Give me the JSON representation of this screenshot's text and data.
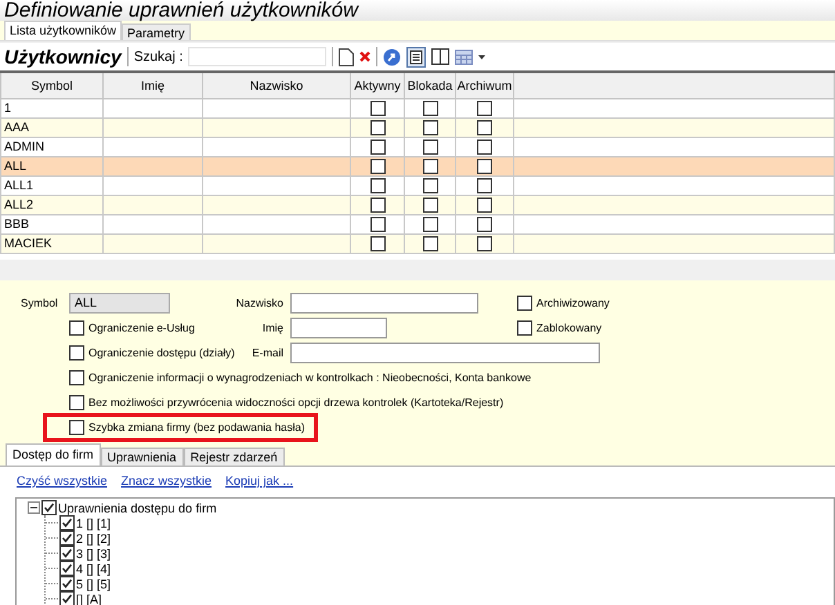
{
  "window": {
    "title": "Definiowanie uprawnień użytkowników"
  },
  "tabs": [
    {
      "label": "Lista użytkowników",
      "selected": true
    },
    {
      "label": "Parametry",
      "selected": false
    }
  ],
  "toolbar": {
    "title": "Użytkownicy",
    "search_label": "Szukaj :"
  },
  "table": {
    "columns": [
      {
        "label": "Symbol",
        "kind": "text"
      },
      {
        "label": "Imię",
        "kind": "text"
      },
      {
        "label": "Nazwisko",
        "kind": "text"
      },
      {
        "label": "Aktywny",
        "kind": "check"
      },
      {
        "label": "Blokada",
        "kind": "check"
      },
      {
        "label": "Archiwum",
        "kind": "check"
      }
    ],
    "rows": [
      {
        "symbol": "1",
        "active": false,
        "blocked": false,
        "archived": false,
        "selected": false
      },
      {
        "symbol": "AAA",
        "active": false,
        "blocked": false,
        "archived": false,
        "selected": false
      },
      {
        "symbol": "ADMIN",
        "active": false,
        "blocked": false,
        "archived": false,
        "selected": false
      },
      {
        "symbol": "ALL",
        "active": false,
        "blocked": false,
        "archived": false,
        "selected": true
      },
      {
        "symbol": "ALL1",
        "active": false,
        "blocked": false,
        "archived": false,
        "selected": false
      },
      {
        "symbol": "ALL2",
        "active": false,
        "blocked": false,
        "archived": false,
        "selected": false
      },
      {
        "symbol": "BBB",
        "active": false,
        "blocked": false,
        "archived": false,
        "selected": false
      },
      {
        "symbol": "MACIEK",
        "active": false,
        "blocked": false,
        "archived": false,
        "selected": false
      }
    ]
  },
  "form": {
    "symbol_label": "Symbol",
    "symbol_value": "ALL",
    "surname_label": "Nazwisko",
    "name_label": "Imię",
    "email_label": "E-mail",
    "archived": {
      "label": "Archiwizowany",
      "checked": false
    },
    "blocked": {
      "label": "Zablokowany",
      "checked": false
    },
    "options": [
      {
        "label": "Ograniczenie e-Usług",
        "checked": false,
        "highlighted": false
      },
      {
        "label": "Ograniczenie dostępu (działy)",
        "checked": false,
        "highlighted": false
      },
      {
        "label": "Ograniczenie informacji o wynagrodzeniach w kontrolkach : Nieobecności, Konta bankowe",
        "checked": false,
        "highlighted": false
      },
      {
        "label": "Bez możliwości przywrócenia widoczności opcji drzewa kontrolek (Kartoteka/Rejestr)",
        "checked": false,
        "highlighted": false
      },
      {
        "label": "Szybka zmiana firmy (bez podawania hasła)",
        "checked": false,
        "highlighted": true
      }
    ]
  },
  "detail_tabs": [
    {
      "label": "Dostęp do firm",
      "selected": true
    },
    {
      "label": "Uprawnienia",
      "selected": false
    },
    {
      "label": "Rejestr zdarzeń",
      "selected": false
    }
  ],
  "links": [
    "Czyść wszystkie",
    "Znacz wszystkie",
    "Kopiuj jak ..."
  ],
  "tree": {
    "label": "Uprawnienia dostępu do firm",
    "checked": true,
    "expanded": true,
    "children": [
      {
        "label": "1 [] [1]",
        "checked": true
      },
      {
        "label": "2 [] [2]",
        "checked": true
      },
      {
        "label": "3 [] [3]",
        "checked": true
      },
      {
        "label": "4 [] [4]",
        "checked": true
      },
      {
        "label": "5 [] [5]",
        "checked": true
      },
      {
        "label": "[] [A]",
        "checked": true
      }
    ]
  }
}
